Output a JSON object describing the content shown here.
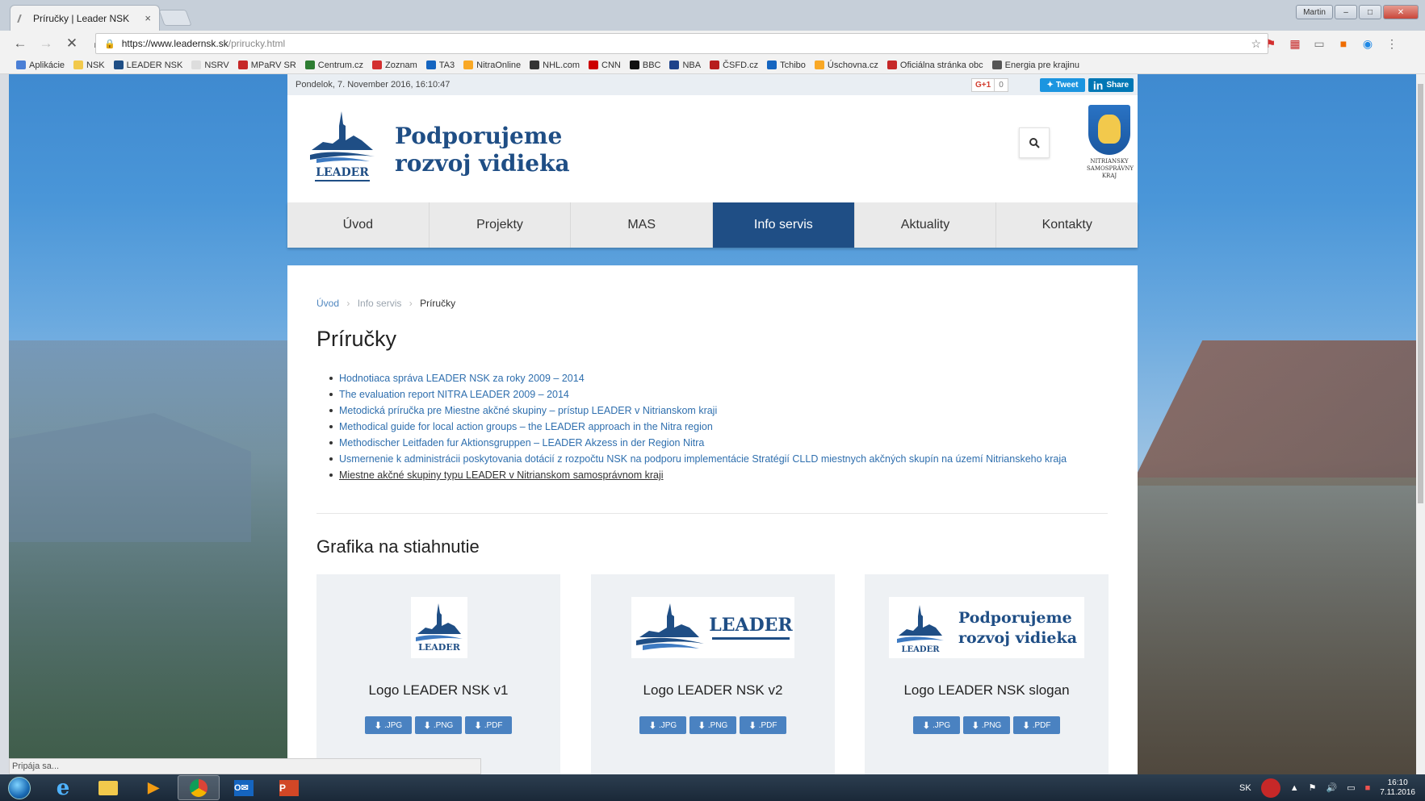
{
  "browser": {
    "tab_title": "Príručky | Leader NSK",
    "tab_close": "×",
    "url_host": "https://www.leadernsk.sk",
    "url_path": "/prirucky.html",
    "nav_icons": [
      "back-arrow-icon",
      "forward-arrow-icon",
      "stop-icon",
      "home-icon"
    ],
    "window": {
      "user": "Martin"
    },
    "bookmarks": [
      {
        "label": "Aplikácie",
        "color": "#4a7fd6"
      },
      {
        "label": "NSK",
        "color": "#f2c94c"
      },
      {
        "label": "LEADER NSK",
        "color": "#1f4e85"
      },
      {
        "label": "NSRV",
        "color": "#dddddd"
      },
      {
        "label": "MPaRV SR",
        "color": "#c62828"
      },
      {
        "label": "Centrum.cz",
        "color": "#2e7d32"
      },
      {
        "label": "Zoznam",
        "color": "#d32f2f"
      },
      {
        "label": "TA3",
        "color": "#1565c0"
      },
      {
        "label": "NitraOnline",
        "color": "#f9a825"
      },
      {
        "label": "NHL.com",
        "color": "#333333"
      },
      {
        "label": "CNN",
        "color": "#cc0000"
      },
      {
        "label": "BBC",
        "color": "#111111"
      },
      {
        "label": "NBA",
        "color": "#1d428a"
      },
      {
        "label": "ČSFD.cz",
        "color": "#b71c1c"
      },
      {
        "label": "Tchibo",
        "color": "#1565c0"
      },
      {
        "label": "Úschovna.cz",
        "color": "#f9a825"
      },
      {
        "label": "Oficiálna stránka obc",
        "color": "#c62828"
      },
      {
        "label": "Energia pre krajinu",
        "color": "#555555"
      }
    ]
  },
  "site": {
    "topbar": {
      "date": "Pondelok, 7. November 2016, 16:10:47",
      "gplus": "G+1",
      "gplus_count": "0",
      "tweet": "Tweet",
      "share_in": "in",
      "share": "Share"
    },
    "logo": {
      "line1": "Podporujeme",
      "line2": "rozvoj vidieka",
      "word": "LEADER"
    },
    "crest": {
      "text1": "NITRIANSKY",
      "text2": "SAMOSPRÁVNY",
      "text3": "KRAJ"
    },
    "nav": [
      {
        "label": "Úvod",
        "active": false
      },
      {
        "label": "Projekty",
        "active": false
      },
      {
        "label": "MAS",
        "active": false
      },
      {
        "label": "Info servis",
        "active": true
      },
      {
        "label": "Aktuality",
        "active": false
      },
      {
        "label": "Kontakty",
        "active": false
      }
    ],
    "breadcrumb": {
      "home": "Úvod",
      "section": "Info servis",
      "current": "Príručky",
      "separator": "›"
    },
    "page_title": "Príručky",
    "links": [
      "Hodnotiaca správa LEADER NSK za roky 2009 – 2014",
      "The evaluation report NITRA LEADER 2009 – 2014",
      "Metodická príručka pre Miestne akčné skupiny – prístup LEADER v Nitrianskom kraji",
      "Methodical guide for local action groups – the LEADER approach in the Nitra region",
      "Methodischer Leitfaden fur Aktionsgruppen – LEADER Akzess in der Region Nitra",
      "Usmernenie k administrácii poskytovania dotácií z rozpočtu NSK na podporu implementácie Stratégií CLLD miestnych akčných skupín na území Nitrianskeho kraja",
      "Miestne akčné skupiny typu LEADER v Nitrianskom samosprávnom kraji"
    ],
    "downloads_title": "Grafika na stiahnutie",
    "cards": [
      {
        "name": "Logo LEADER NSK v1",
        "jpg": ".JPG",
        "png": ".PNG",
        "pdf": ".PDF"
      },
      {
        "name": "Logo LEADER NSK v2",
        "jpg": ".JPG",
        "png": ".PNG",
        "pdf": ".PDF"
      },
      {
        "name": "Logo LEADER NSK slogan",
        "jpg": ".JPG",
        "png": ".PNG",
        "pdf": ".PDF"
      }
    ]
  },
  "status_text": "Pripája sa...",
  "taskbar": {
    "lang": "SK",
    "time": "16:10",
    "date": "7.11.2016",
    "apps": [
      "start-orb",
      "ie",
      "explorer",
      "media-player",
      "chrome",
      "outlook",
      "powerpoint"
    ]
  },
  "colors": {
    "brand": "#1f4e85",
    "link": "#2f6fae",
    "button": "#4a82c1"
  }
}
